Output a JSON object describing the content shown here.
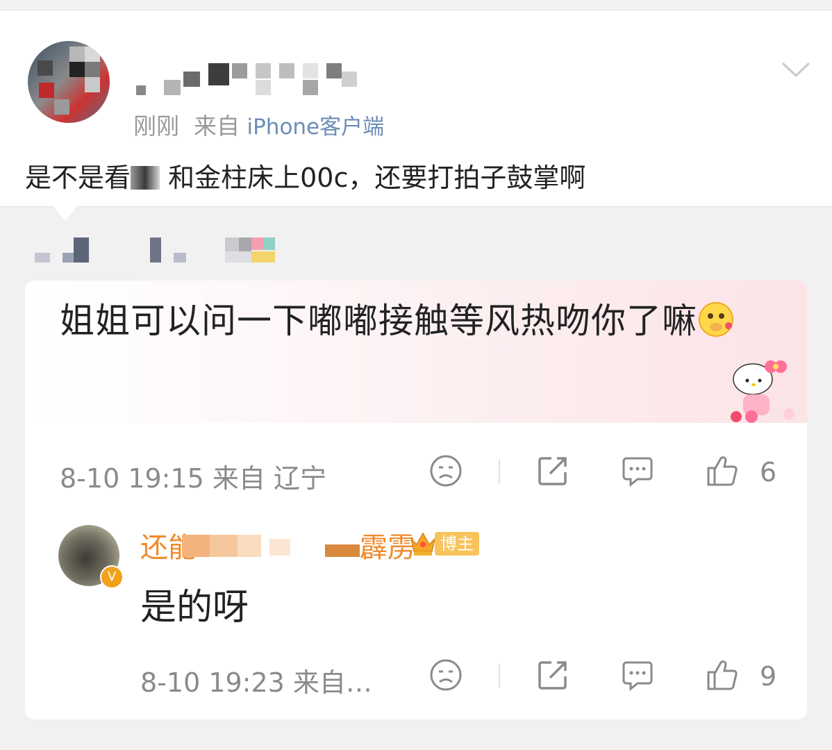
{
  "post": {
    "time": "刚刚",
    "from_label": "来自",
    "source": "iPhone客户端",
    "text_before": "是不是看",
    "text_after": "和金柱床上00c，还要打拍子鼓掌啊"
  },
  "comment": {
    "text": "姐姐可以问一下嘟嘟接触等风热吻你了嘛",
    "meta": "8-10 19:15 来自 辽宁",
    "like_count": "6"
  },
  "reply": {
    "name_prefix": "还能",
    "name_suffix": "霹雳",
    "badge_label": "博主",
    "verified_mark": "V",
    "text": "是的呀",
    "meta": "8-10 19:23 来自…",
    "like_count": "9"
  },
  "icons": [
    "chevron-down-icon",
    "dislike-face-icon",
    "share-icon",
    "comment-icon",
    "thumbs-up-icon",
    "crown-icon",
    "emoji-blush-icon",
    "hello-kitty-sticker"
  ],
  "colors": {
    "meta_gray": "#8a8a8a",
    "source_blue": "#6c8db5",
    "reply_name_orange": "#f08a2a",
    "badge_gold": "#f7c35a",
    "bubble_pink": "#fbe3e6"
  }
}
